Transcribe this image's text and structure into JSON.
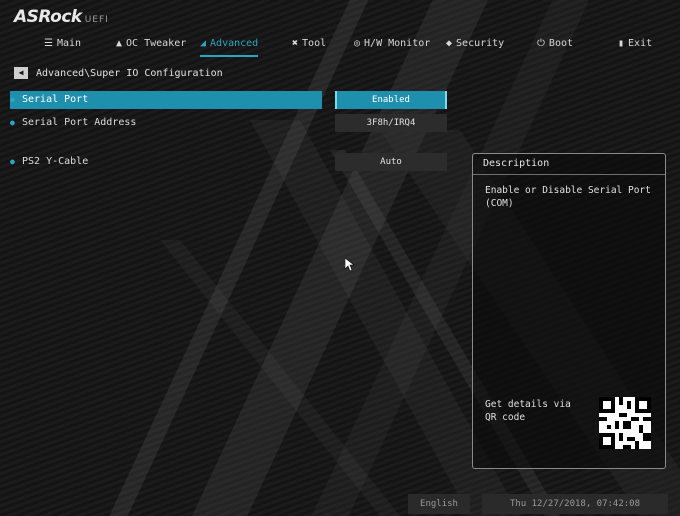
{
  "brand": {
    "name": "ASRock",
    "suffix": "UEFI"
  },
  "tabs": [
    {
      "label": "Main",
      "icon": "list-icon",
      "active": false
    },
    {
      "label": "OC Tweaker",
      "icon": "rocket-icon",
      "active": false
    },
    {
      "label": "Advanced",
      "icon": "advanced-icon",
      "active": true
    },
    {
      "label": "Tool",
      "icon": "tool-icon",
      "active": false
    },
    {
      "label": "H/W Monitor",
      "icon": "monitor-icon",
      "active": false
    },
    {
      "label": "Security",
      "icon": "shield-icon",
      "active": false
    },
    {
      "label": "Boot",
      "icon": "power-icon",
      "active": false
    },
    {
      "label": "Exit",
      "icon": "exit-icon",
      "active": false
    }
  ],
  "breadcrumb": "Advanced\\Super IO Configuration",
  "settings": [
    {
      "label": "Serial Port",
      "value": "Enabled",
      "selected": true
    },
    {
      "label": "Serial Port Address",
      "value": "3F8h/IRQ4",
      "selected": false
    },
    {
      "label": "PS2 Y-Cable",
      "value": "Auto",
      "selected": false
    }
  ],
  "description": {
    "title": "Description",
    "text": "Enable or Disable Serial Port (COM)",
    "qr_text": "Get details via QR code"
  },
  "status_bar": {
    "language": "English",
    "datetime": "Thu 12/27/2018, 07:42:08"
  },
  "colors": {
    "accent": "#2aa6c2",
    "highlight": "#1f8fae"
  }
}
